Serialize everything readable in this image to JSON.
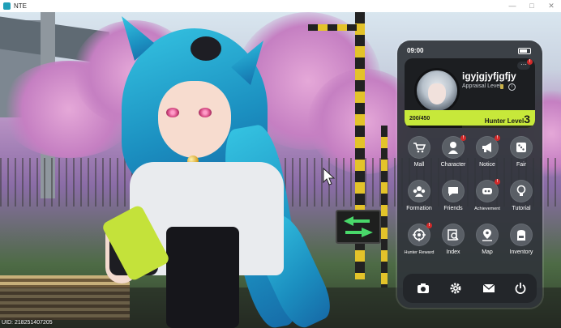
{
  "window": {
    "title": "NTE"
  },
  "hud": {
    "uid_text": "UID: 218251407205"
  },
  "phone": {
    "status_time": "09:00",
    "profile": {
      "username": "igyjgjyfjgfjy",
      "appraisal_label": "Appraisal Level",
      "exp_text": "200/450",
      "exp_fraction": 0.444,
      "hunter_level_label": "Hunter Level",
      "hunter_level_value": "3",
      "more_badge": "!"
    },
    "apps": [
      {
        "label": "Mall",
        "icon": "cart-icon",
        "badge": ""
      },
      {
        "label": "Character",
        "icon": "character-icon",
        "badge": "!"
      },
      {
        "label": "Notice",
        "icon": "megaphone-icon",
        "badge": "!"
      },
      {
        "label": "Fair",
        "icon": "dice-icon",
        "badge": ""
      },
      {
        "label": "Formation",
        "icon": "formation-icon",
        "badge": ""
      },
      {
        "label": "Friends",
        "icon": "chat-bubble-icon",
        "badge": ""
      },
      {
        "label": "Achievement",
        "icon": "trophy-icon",
        "badge": "!"
      },
      {
        "label": "Tutorial",
        "icon": "lightbulb-icon",
        "badge": ""
      },
      {
        "label": "Hunter Reward",
        "icon": "target-icon",
        "badge": "!"
      },
      {
        "label": "Index",
        "icon": "search-book-icon",
        "badge": ""
      },
      {
        "label": "Map",
        "icon": "map-pin-icon",
        "badge": ""
      },
      {
        "label": "Inventory",
        "icon": "backpack-icon",
        "badge": ""
      }
    ],
    "dock": [
      {
        "icon": "camera-icon"
      },
      {
        "icon": "gear-icon"
      },
      {
        "icon": "mail-icon"
      },
      {
        "icon": "power-icon"
      }
    ],
    "colors": {
      "level_bar": "#c7e83a",
      "badge_red": "#d12a2a",
      "panel": "#30343a"
    }
  }
}
